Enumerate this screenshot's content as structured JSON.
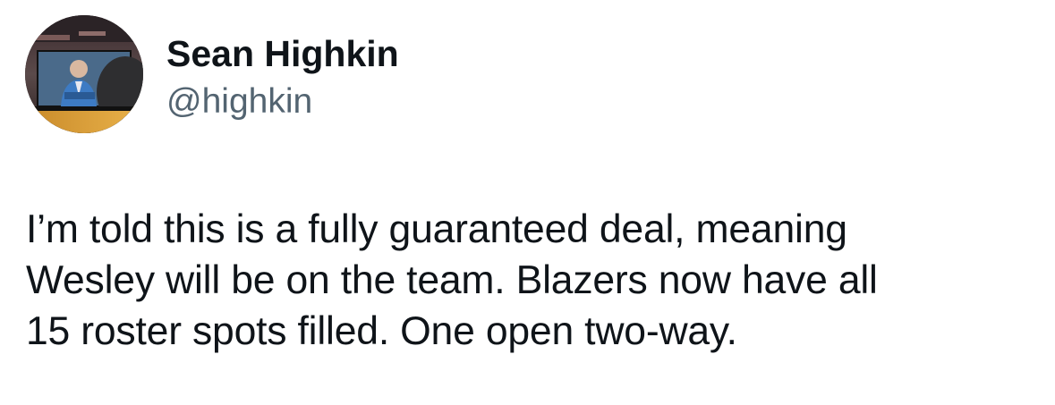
{
  "author": {
    "display_name": "Sean Highkin",
    "handle": "@highkin",
    "avatar_icon": "profile-photo-icon"
  },
  "tweet": {
    "text": "I’m told this is a fully guaranteed deal, meaning\nWesley will be on the team. Blazers now have all\n15 roster spots filled. One open two-way."
  }
}
